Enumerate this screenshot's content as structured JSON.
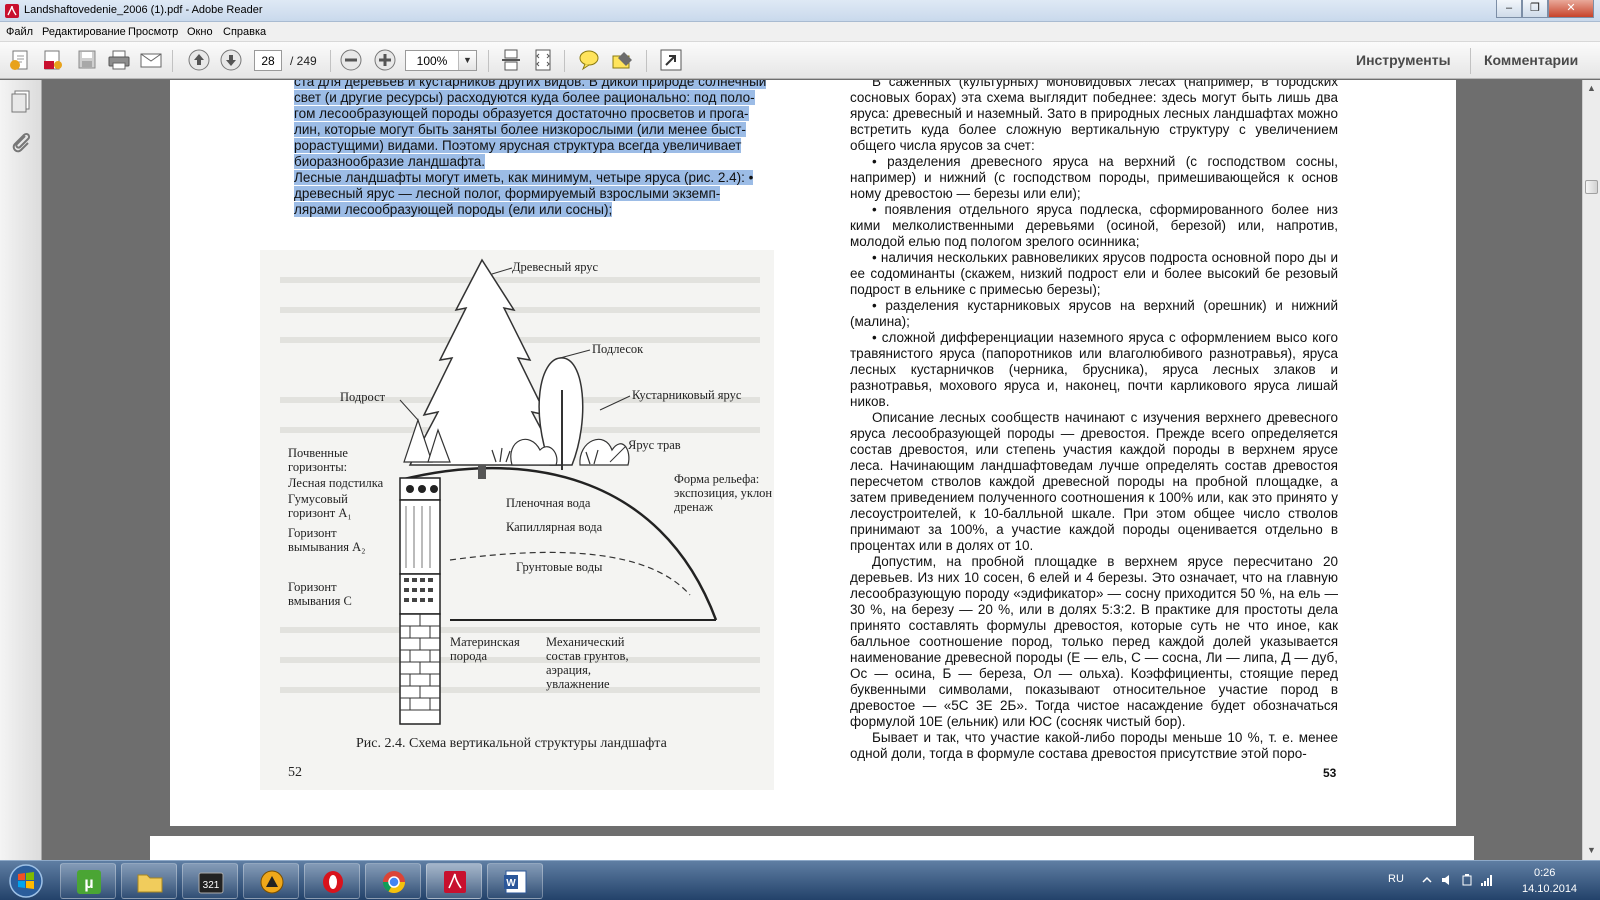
{
  "window": {
    "title": "Landshaftovedenie_2006 (1).pdf - Adobe Reader",
    "minimize": "–",
    "maximize": "❐",
    "close": "✕"
  },
  "menu": [
    "Файл",
    "Редактирование",
    "Просмотр",
    "Окно",
    "Справка"
  ],
  "toolbar": {
    "page_current": "28",
    "page_total": "/ 249",
    "zoom": "100%",
    "tools_label": "Инструменты",
    "comments_label": "Комментарии"
  },
  "document": {
    "left_top_lines": [
      "ста для деревьев и кустарников других видов. В дикой природе солнечный",
      "свет (и другие ресурсы) расходуются куда более рационально: под поло-",
      "гом лесообразующей породы образуется достаточно просветов и прога-",
      "лин, которые могут быть заняты более низкорослыми (или менее быст-",
      "рорастущими) видами. Поэтому ярусная структура всегда увеличивает",
      "биоразнообразие ландшафта.",
      "Лесные ландшафты могут иметь, как минимум, четыре яруса (рис. 2.4): •",
      "древесный ярус — лесной полог, формируемый взрослыми экземп-",
      "лярами лесообразующей породы (ели или сосны);"
    ],
    "figure": {
      "labels": {
        "tree_layer": "Древесный ярус",
        "undergrowth": "Подлесок",
        "young_growth": "Подрост",
        "shrub_layer": "Кустарниковый ярус",
        "grass_layer": "Ярус трав",
        "soil_horizons": "Почвенные горизонты:",
        "litter": "Лесная подстилка",
        "humus": "Гумусовый горизонт A₁",
        "leaching": "Горизонт вымывания A₂",
        "washout": "Горизонт вмывания C",
        "parent_rock": "Материнская порода",
        "film_water": "Пленочная вода",
        "capillary_water": "Капиллярная вода",
        "ground_water": "Грунтовые воды",
        "relief": "Форма рельефа: экспозиция, уклон дренаж",
        "mechanical": "Механический состав грунтов, аэрация, увлажнение"
      },
      "caption": "Рис. 2.4. Схема вертикальной структуры ландшафта"
    },
    "left_page_number": "52",
    "right_paragraphs": [
      "В саженных (культурных) моновидовых лесах (например, в городских сосновых борах) эта схема выглядит победнее: здесь могут быть лишь два яруса: древесный и наземный. Зато в природных лесных ландшафтах можно встретить куда более сложную вертикальную структуру с увеличением общего числа ярусов за счет:",
      "• разделения древесного яруса на верхний (с господством сосны, например) и нижний (с господством породы, примешивающейся к основ ному древостою — березы или ели);",
      "• появления отдельного яруса подлеска, сформированного более низ кими мелколиственными деревьями (осиной, березой) или, напротив, молодой елью под пологом зрелого осинника;",
      "• наличия нескольких равновеликих ярусов подроста основной поро ды и ее содоминанты (скажем, низкий подрост ели и более высокий бе резовый подрост в ельнике с примесью березы);",
      "• разделения кустарниковых ярусов на верхний (орешник) и нижний (малина);",
      "• сложной дифференциации наземного яруса с оформлением высо кого травянистого яруса (папоротников или влаголюбивого разнотравья), яруса лесных кустарничков (черника, брусника), яруса лесных злаков и разнотравья, мохового яруса и, наконец, почти карликового яруса лишай ников.",
      "Описание лесных сообществ начинают с изучения верхнего древесного яруса лесообразующей породы — древостоя. Прежде всего определяется состав древостоя, или степень участия каждой породы в верхнем ярусе леса. Начинающим ландшафтоведам лучше определять состав древостоя пересчетом стволов каждой древесной породы на пробной площадке, а затем приведением полученного соотношения к 100% или, как это принято у лесоустроителей, к 10-балльной шкале. При этом общее число стволов принимают за 100%, а участие каждой породы оценивается отдельно в процентах или в долях от 10.",
      "Допустим, на пробной площадке в верхнем ярусе пересчитано 20 деревьев. Из них 10 сосен, 6 елей и 4 березы. Это означает, что на главную лесообразующую породу «эдификатор» — сосну приходится 50 %, на ель — 30 %, на березу — 20 %, или в долях 5:3:2. В практике для простоты дела принято составлять формулы древостоя, которые суть не что иное, как балльное соотношение пород, только перед каждой долей указывается наименование древесной породы (Е — ель, С — сосна, Ли — липа, Д — дуб, Ос — осина, Б — береза, Ол — ольха). Коэффициенты, стоящие перед буквенными символами, показывают относительное участие пород в древостое — «5С 3Е 2Б». Тогда чистое насаждение будет обозначаться формулой 10Е (ельник) или ЮС (сосняк чистый бор).",
      "Бывает и так, что участие какой-либо породы меньше 10 %, т. е. менее одной доли, тогда в формуле состава древостоя присутствие этой поро-"
    ],
    "right_page_number": "53"
  },
  "taskbar": {
    "lang": "RU",
    "time": "0:26",
    "date": "14.10.2014"
  }
}
